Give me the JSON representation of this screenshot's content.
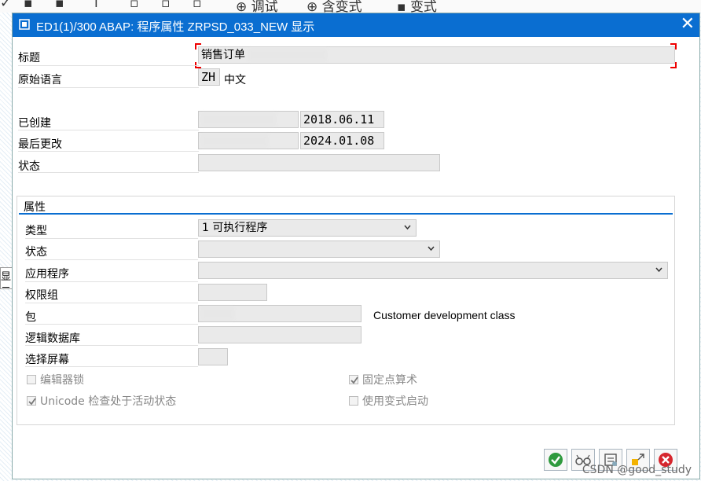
{
  "background": {
    "toolbar_items": [
      "调试",
      "含变式",
      "变式"
    ],
    "side_label": "显示"
  },
  "dialog": {
    "title": "ED1(1)/300 ABAP: 程序属性 ZRPSD_033_NEW 显示",
    "title_bar_color": "#0a6ed1",
    "close_icon": "close-icon"
  },
  "header_fields": {
    "title_label": "标题",
    "title_value": "销售订单",
    "language_label": "原始语言",
    "language_code": "ZH",
    "language_name": "中文",
    "created_label": "已创建",
    "created_by": "",
    "created_date": "2018.06.11",
    "changed_label": "最后更改",
    "changed_by": "",
    "changed_date": "2024.01.08",
    "status_label": "状态",
    "status_value": ""
  },
  "attributes": {
    "group_title": "属性",
    "type_label": "类型",
    "type_value": "1 可执行程序",
    "status_label": "状态",
    "status_value": "",
    "application_label": "应用程序",
    "application_value": "",
    "auth_group_label": "权限组",
    "auth_group_value": "",
    "package_label": "包",
    "package_value": "",
    "package_description": "Customer development class",
    "logical_db_label": "逻辑数据库",
    "logical_db_value": "",
    "selection_screen_label": "选择屏幕",
    "selection_screen_value": "",
    "checkboxes": [
      {
        "label": "编辑器锁",
        "checked": false
      },
      {
        "label": "Unicode 检查处于活动状态",
        "checked": true
      },
      {
        "label": "固定点算术",
        "checked": true
      },
      {
        "label": "使用变式启动",
        "checked": false
      }
    ]
  },
  "footer": {
    "buttons": [
      "confirm-icon",
      "glasses-icon",
      "tree-icon",
      "tag-icon",
      "cancel-icon"
    ],
    "watermark": "CSDN @good_study"
  }
}
